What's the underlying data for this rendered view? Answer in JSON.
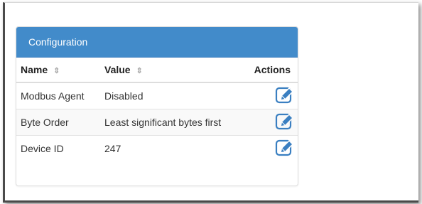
{
  "panel": {
    "title": "Configuration"
  },
  "table": {
    "columns": [
      {
        "label": "Name",
        "sortable": true
      },
      {
        "label": "Value",
        "sortable": true
      },
      {
        "label": "Actions",
        "sortable": false
      }
    ],
    "sort_icon": "sort-arrows-icon",
    "rows": [
      {
        "name": "Modbus Agent",
        "value": "Disabled",
        "action_icon": "edit-icon"
      },
      {
        "name": "Byte Order",
        "value": "Least significant bytes first",
        "action_icon": "edit-icon"
      },
      {
        "name": "Device ID",
        "value": "247",
        "action_icon": "edit-icon"
      }
    ]
  },
  "colors": {
    "heading": "#428bca",
    "icon": "#3a7fc1"
  }
}
